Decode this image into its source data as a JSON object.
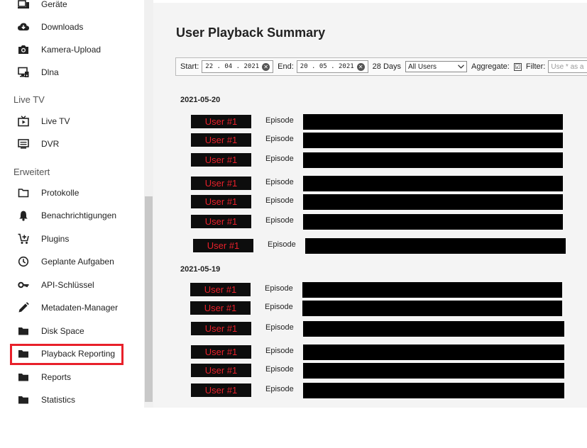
{
  "sidebar": {
    "items": [
      {
        "label": "Geräte",
        "icon": "devices-icon"
      },
      {
        "label": "Downloads",
        "icon": "cloud-download-icon"
      },
      {
        "label": "Kamera-Upload",
        "icon": "camera-icon"
      },
      {
        "label": "Dlna",
        "icon": "dlna-icon"
      },
      {
        "label": "Live TV",
        "icon": "live-tv-icon"
      },
      {
        "label": "DVR",
        "icon": "dvr-icon"
      },
      {
        "label": "Protokolle",
        "icon": "folder-open-icon"
      },
      {
        "label": "Benachrichtigungen",
        "icon": "bell-icon"
      },
      {
        "label": "Plugins",
        "icon": "cart-plus-icon"
      },
      {
        "label": "Geplante Aufgaben",
        "icon": "clock-icon"
      },
      {
        "label": "API-Schlüssel",
        "icon": "key-icon"
      },
      {
        "label": "Metadaten-Manager",
        "icon": "pencil-icon"
      },
      {
        "label": "Disk Space",
        "icon": "folder-icon"
      },
      {
        "label": "Playback Reporting",
        "icon": "folder-icon"
      },
      {
        "label": "Reports",
        "icon": "folder-icon"
      },
      {
        "label": "Statistics",
        "icon": "folder-icon"
      }
    ],
    "sections": {
      "live_tv": "Live TV",
      "erweitert": "Erweitert"
    },
    "highlighted_item": "Playback Reporting"
  },
  "main": {
    "title": "User Playback Summary",
    "toolbar": {
      "start_label": "Start:",
      "start_value": "22 . 04 . 2021",
      "end_label": "End:",
      "end_value": "20 . 05 . 2021",
      "days": "28 Days",
      "users_select": "All Users",
      "aggregate_label": "Aggregate:",
      "aggregate_checked": "☑",
      "filter_label": "Filter:",
      "filter_placeholder": "Use * as a"
    },
    "groups": [
      {
        "date": "2021-05-20",
        "rows": [
          {
            "user": "User #1",
            "type": "Episode"
          },
          {
            "user": "User #1",
            "type": "Episode"
          },
          {
            "user": "User #1",
            "type": "Episode"
          },
          {
            "user": "User #1",
            "type": "Episode"
          },
          {
            "user": "User #1",
            "type": "Episode"
          },
          {
            "user": "User #1",
            "type": "Episode"
          },
          {
            "user": "User #1",
            "type": "Episode"
          }
        ]
      },
      {
        "date": "2021-05-19",
        "rows": [
          {
            "user": "User #1",
            "type": "Episode"
          },
          {
            "user": "User #1",
            "type": "Episode"
          },
          {
            "user": "User #1",
            "type": "Episode"
          },
          {
            "user": "User #1",
            "type": "Episode"
          },
          {
            "user": "User #1",
            "type": "Episode"
          },
          {
            "user": "User #1",
            "type": "Episode"
          }
        ]
      }
    ]
  },
  "colors": {
    "accent_red": "#e8202a",
    "badge_bg": "#0d0d0d",
    "content_bg": "#f4f4f4"
  }
}
